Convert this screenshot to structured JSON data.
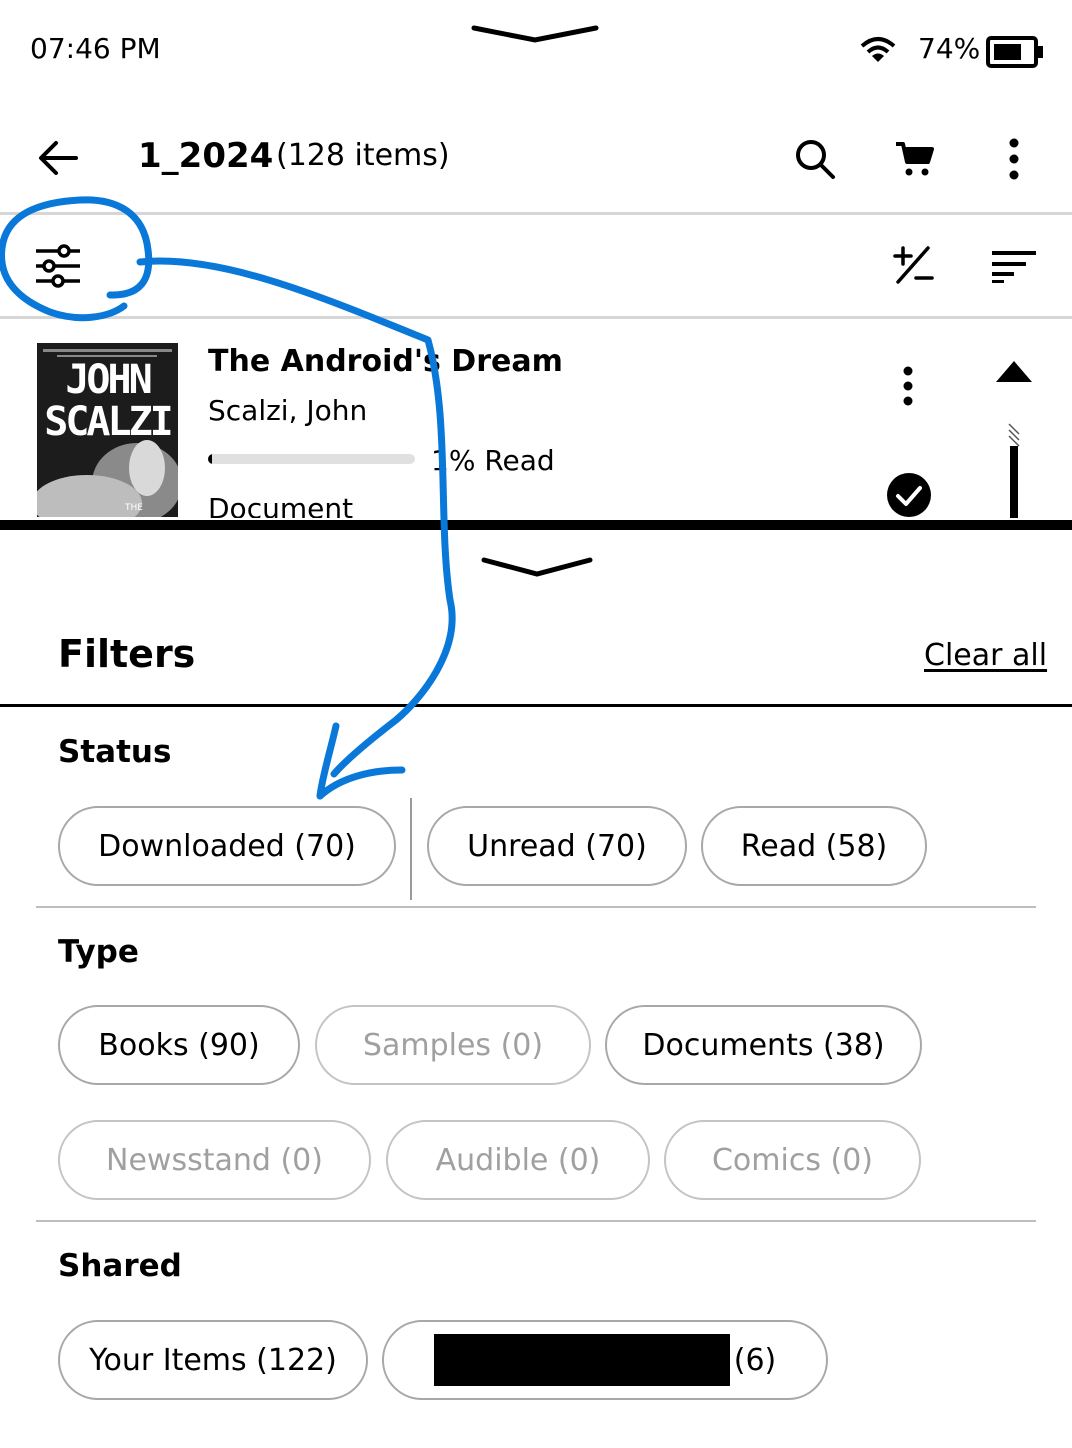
{
  "status_bar": {
    "time": "07:46 PM",
    "battery_percent": "74%",
    "battery_level": 0.74
  },
  "header": {
    "title": "1_2024",
    "item_count": "(128 items)",
    "icons": [
      "back-arrow-icon",
      "search-icon",
      "cart-icon",
      "more-vert-icon"
    ]
  },
  "toolbar": {
    "icons": [
      "filter-sliders-icon",
      "plus-minus-icon",
      "sort-icon"
    ]
  },
  "book": {
    "title": "The Android's Dream",
    "author": "Scalzi, John",
    "progress_label": "1% Read",
    "progress_fraction": 0.01,
    "type": "Document",
    "cover_text_line1": "JOHN",
    "cover_text_line2": "SCALZI",
    "cover_small": "THE"
  },
  "filters": {
    "title": "Filters",
    "clear_all": "Clear all",
    "status": {
      "title": "Status",
      "chips": [
        "Downloaded (70)",
        "Unread (70)",
        "Read (58)"
      ]
    },
    "type": {
      "title": "Type",
      "chips": [
        "Books (90)",
        "Samples (0)",
        "Documents (38)",
        "Newsstand (0)",
        "Audible (0)",
        "Comics (0)"
      ],
      "disabled": [
        "Samples (0)",
        "Newsstand (0)",
        "Audible (0)",
        "Comics (0)"
      ]
    },
    "shared": {
      "title": "Shared",
      "chips": [
        "Your Items (122)"
      ],
      "redacted_chip_count": "(6)"
    }
  },
  "annotation_color": "#0a78d8"
}
